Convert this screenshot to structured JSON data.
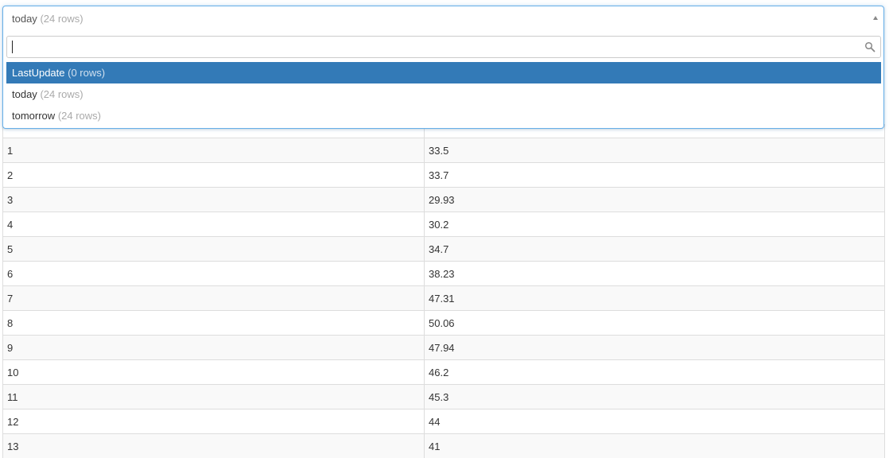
{
  "select": {
    "current_label": "today",
    "current_count": "(24 rows)",
    "search_value": "",
    "options": [
      {
        "label": "LastUpdate",
        "count": "(0 rows)",
        "active": true
      },
      {
        "label": "today",
        "count": "(24 rows)",
        "active": false
      },
      {
        "label": "tomorrow",
        "count": "(24 rows)",
        "active": false
      }
    ]
  },
  "table": {
    "rows": [
      {
        "hour": "1",
        "value": "33.5"
      },
      {
        "hour": "2",
        "value": "33.7"
      },
      {
        "hour": "3",
        "value": "29.93"
      },
      {
        "hour": "4",
        "value": "30.2"
      },
      {
        "hour": "5",
        "value": "34.7"
      },
      {
        "hour": "6",
        "value": "38.23"
      },
      {
        "hour": "7",
        "value": "47.31"
      },
      {
        "hour": "8",
        "value": "50.06"
      },
      {
        "hour": "9",
        "value": "47.94"
      },
      {
        "hour": "10",
        "value": "46.2"
      },
      {
        "hour": "11",
        "value": "45.3"
      },
      {
        "hour": "12",
        "value": "44"
      },
      {
        "hour": "13",
        "value": "41"
      }
    ]
  },
  "colors": {
    "accent": "#337ab7",
    "focus_border": "#66afe9",
    "muted_text": "#aaaaaa"
  },
  "icons": {
    "search": "search-icon",
    "caret": "caret-up-icon"
  }
}
